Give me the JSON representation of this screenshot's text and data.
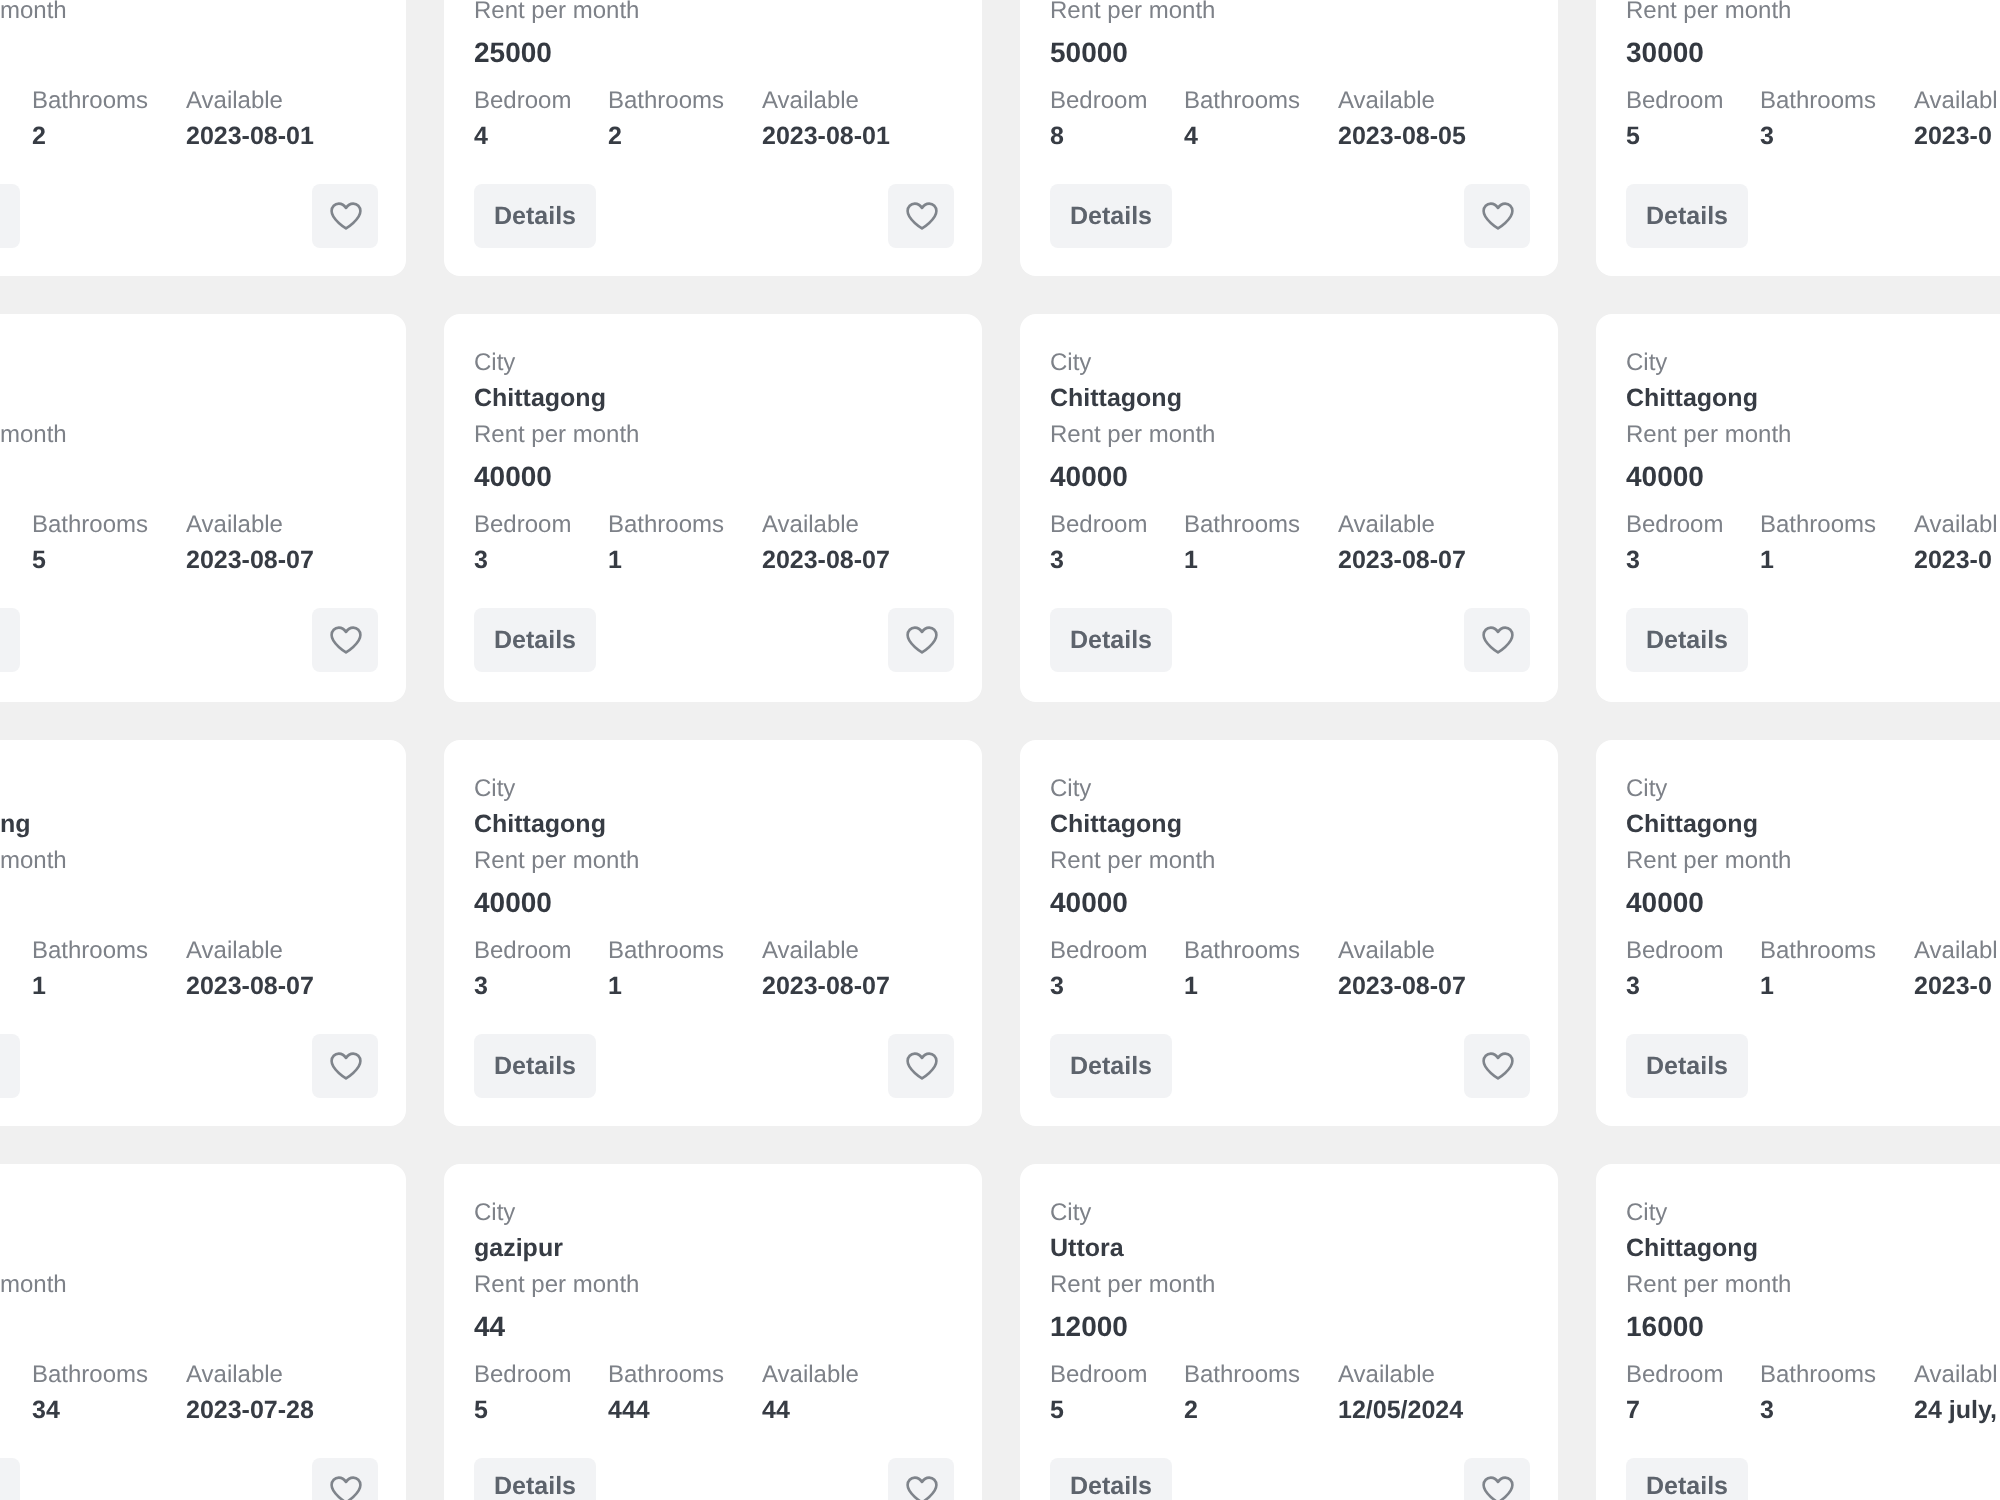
{
  "listings": [
    {
      "rent_label": "month",
      "fields": [
        {
          "label": "Bathrooms",
          "value": "2"
        },
        {
          "label": "Available",
          "value": "2023-08-01"
        }
      ],
      "favorite": false
    },
    {
      "rent_label": "Rent per month",
      "rent": "25000",
      "fields": [
        {
          "label": "Bedroom",
          "value": "4"
        },
        {
          "label": "Bathrooms",
          "value": "2"
        },
        {
          "label": "Available",
          "value": "2023-08-01"
        }
      ],
      "details_button": "Details",
      "favorite": false
    },
    {
      "rent_label": "Rent per month",
      "rent": "50000",
      "fields": [
        {
          "label": "Bedroom",
          "value": "8"
        },
        {
          "label": "Bathrooms",
          "value": "4"
        },
        {
          "label": "Available",
          "value": "2023-08-05"
        }
      ],
      "details_button": "Details",
      "favorite": false
    },
    {
      "rent_label": "Rent per month",
      "rent": "30000",
      "fields": [
        {
          "label": "Bedroom",
          "value": "5"
        },
        {
          "label": "Bathrooms",
          "value": "3"
        },
        {
          "label": "Availabl",
          "value": "2023-0"
        }
      ],
      "details_button": "Details"
    },
    {
      "rent_label": "month",
      "fields": [
        {
          "label": "Bathrooms",
          "value": "5"
        },
        {
          "label": "Available",
          "value": "2023-08-07"
        }
      ],
      "favorite": false
    },
    {
      "city_label": "City",
      "city": "Chittagong",
      "rent_label": "Rent per month",
      "rent": "40000",
      "fields": [
        {
          "label": "Bedroom",
          "value": "3"
        },
        {
          "label": "Bathrooms",
          "value": "1"
        },
        {
          "label": "Available",
          "value": "2023-08-07"
        }
      ],
      "details_button": "Details",
      "favorite": false
    },
    {
      "city_label": "City",
      "city": "Chittagong",
      "rent_label": "Rent per month",
      "rent": "40000",
      "fields": [
        {
          "label": "Bedroom",
          "value": "3"
        },
        {
          "label": "Bathrooms",
          "value": "1"
        },
        {
          "label": "Available",
          "value": "2023-08-07"
        }
      ],
      "details_button": "Details",
      "favorite": false
    },
    {
      "city_label": "City",
      "city": "Chittagong",
      "rent_label": "Rent per month",
      "rent": "40000",
      "fields": [
        {
          "label": "Bedroom",
          "value": "3"
        },
        {
          "label": "Bathrooms",
          "value": "1"
        },
        {
          "label": "Availabl",
          "value": "2023-0"
        }
      ],
      "details_button": "Details"
    },
    {
      "city": "ng",
      "rent_label": "month",
      "fields": [
        {
          "label": "Bathrooms",
          "value": "1"
        },
        {
          "label": "Available",
          "value": "2023-08-07"
        }
      ],
      "favorite": false
    },
    {
      "city_label": "City",
      "city": "Chittagong",
      "rent_label": "Rent per month",
      "rent": "40000",
      "fields": [
        {
          "label": "Bedroom",
          "value": "3"
        },
        {
          "label": "Bathrooms",
          "value": "1"
        },
        {
          "label": "Available",
          "value": "2023-08-07"
        }
      ],
      "details_button": "Details",
      "favorite": false
    },
    {
      "city_label": "City",
      "city": "Chittagong",
      "rent_label": "Rent per month",
      "rent": "40000",
      "fields": [
        {
          "label": "Bedroom",
          "value": "3"
        },
        {
          "label": "Bathrooms",
          "value": "1"
        },
        {
          "label": "Available",
          "value": "2023-08-07"
        }
      ],
      "details_button": "Details",
      "favorite": false
    },
    {
      "city_label": "City",
      "city": "Chittagong",
      "rent_label": "Rent per month",
      "rent": "40000",
      "fields": [
        {
          "label": "Bedroom",
          "value": "3"
        },
        {
          "label": "Bathrooms",
          "value": "1"
        },
        {
          "label": "Availabl",
          "value": "2023-0"
        }
      ],
      "details_button": "Details"
    },
    {
      "rent_label": "month",
      "fields": [
        {
          "label": "Bathrooms",
          "value": "34"
        },
        {
          "label": "Available",
          "value": "2023-07-28"
        }
      ],
      "favorite": false
    },
    {
      "city_label": "City",
      "city": "gazipur",
      "rent_label": "Rent per month",
      "rent": "44",
      "fields": [
        {
          "label": "Bedroom",
          "value": "5"
        },
        {
          "label": "Bathrooms",
          "value": "444"
        },
        {
          "label": "Available",
          "value": "44"
        }
      ],
      "details_button": "Details",
      "favorite": false
    },
    {
      "city_label": "City",
      "city": "Uttora",
      "rent_label": "Rent per month",
      "rent": "12000",
      "fields": [
        {
          "label": "Bedroom",
          "value": "5"
        },
        {
          "label": "Bathrooms",
          "value": "2"
        },
        {
          "label": "Available",
          "value": "12/05/2024"
        }
      ],
      "details_button": "Details",
      "favorite": false
    },
    {
      "city_label": "City",
      "city": "Chittagong",
      "rent_label": "Rent per month",
      "rent": "16000",
      "fields": [
        {
          "label": "Bedroom",
          "value": "7"
        },
        {
          "label": "Bathrooms",
          "value": "3"
        },
        {
          "label": "Availabl",
          "value": "24 july,"
        }
      ],
      "details_button": "Details"
    }
  ]
}
